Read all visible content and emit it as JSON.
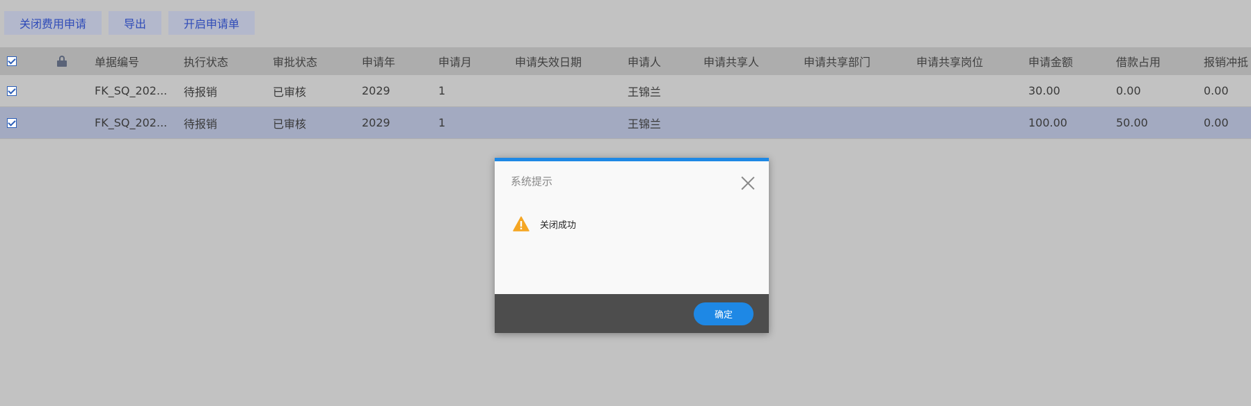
{
  "toolbar": {
    "close_request": "关闭费用申请",
    "export": "导出",
    "open_request": "开启申请单"
  },
  "table": {
    "headers": [
      "单据编号",
      "执行状态",
      "审批状态",
      "申请年",
      "申请月",
      "申请失效日期",
      "申请人",
      "申请共享人",
      "申请共享部门",
      "申请共享岗位",
      "申请金额",
      "借款占用",
      "报销冲抵"
    ],
    "rows": [
      [
        "FK_SQ_202...",
        "待报销",
        "已审核",
        "2029",
        "1",
        "",
        "王锦兰",
        "",
        "",
        "",
        "30.00",
        "0.00",
        "0.00"
      ],
      [
        "FK_SQ_202...",
        "待报销",
        "已审核",
        "2029",
        "1",
        "",
        "王锦兰",
        "",
        "",
        "",
        "100.00",
        "50.00",
        "0.00"
      ]
    ]
  },
  "dialog": {
    "title": "系统提示",
    "message": "关闭成功",
    "ok_label": "确定"
  },
  "colors": {
    "accent": "#1e88e5",
    "selected_row": "#a3aac1",
    "warning": "#f5a623"
  },
  "icons": {
    "lock": "lock-icon",
    "warning": "warning-icon",
    "close": "close-icon",
    "checkbox": "checkbox-checked-icon"
  }
}
